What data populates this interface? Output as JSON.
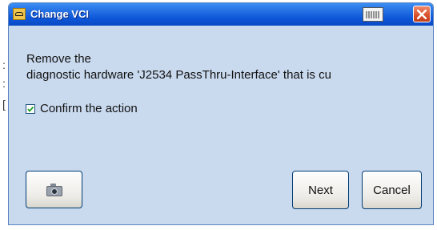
{
  "dialog": {
    "title": "Change VCI",
    "message_line1": "Remove the",
    "message_line2": "diagnostic hardware 'J2534 PassThru-Interface' that is cu",
    "checkbox_label": "Confirm the action",
    "checkbox_checked": true,
    "next_label": "Next",
    "cancel_label": "Cancel"
  },
  "icons": {
    "app": "car-warning-icon",
    "keyboard": "keyboard-icon",
    "close": "close-icon",
    "camera": "camera-icon"
  },
  "colors": {
    "titlebar": "#0c55d8",
    "dialog_bg": "#c9d9ee",
    "close": "#d8502b"
  }
}
